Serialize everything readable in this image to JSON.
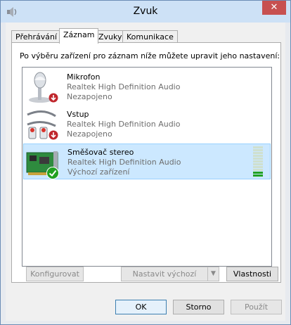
{
  "window": {
    "title": "Zvuk",
    "close_glyph": "✕",
    "app_icon": "speaker-settings-icon"
  },
  "tabs": [
    {
      "label": "Přehrávání",
      "active": false
    },
    {
      "label": "Záznam",
      "active": true
    },
    {
      "label": "Zvuky",
      "active": false
    },
    {
      "label": "Komunikace",
      "active": false
    }
  ],
  "instruction": "Po výběru zařízení pro záznam níže můžete upravit jeho nastavení:",
  "devices": [
    {
      "name": "Mikrofon",
      "driver": "Realtek High Definition Audio",
      "status": "Nezapojeno",
      "icon": "microphone-icon",
      "badge": "unplugged-arrow-icon",
      "selected": false
    },
    {
      "name": "Vstup",
      "driver": "Realtek High Definition Audio",
      "status": "Nezapojeno",
      "icon": "line-in-cable-icon",
      "badge": "unplugged-arrow-icon",
      "selected": false
    },
    {
      "name": "Směšovač stereo",
      "driver": "Realtek High Definition Audio",
      "status": "Výchozí zařízení",
      "icon": "sound-card-icon",
      "badge": "default-checkmark-icon",
      "selected": true,
      "level": 0.2
    }
  ],
  "buttons": {
    "configure": "Konfigurovat",
    "set_default": "Nastavit výchozí",
    "properties": "Vlastnosti",
    "ok": "OK",
    "cancel": "Storno",
    "apply": "Použít"
  },
  "colors": {
    "selection": "#cce8ff",
    "meter_active": "#21a121",
    "close_button": "#c75050"
  }
}
